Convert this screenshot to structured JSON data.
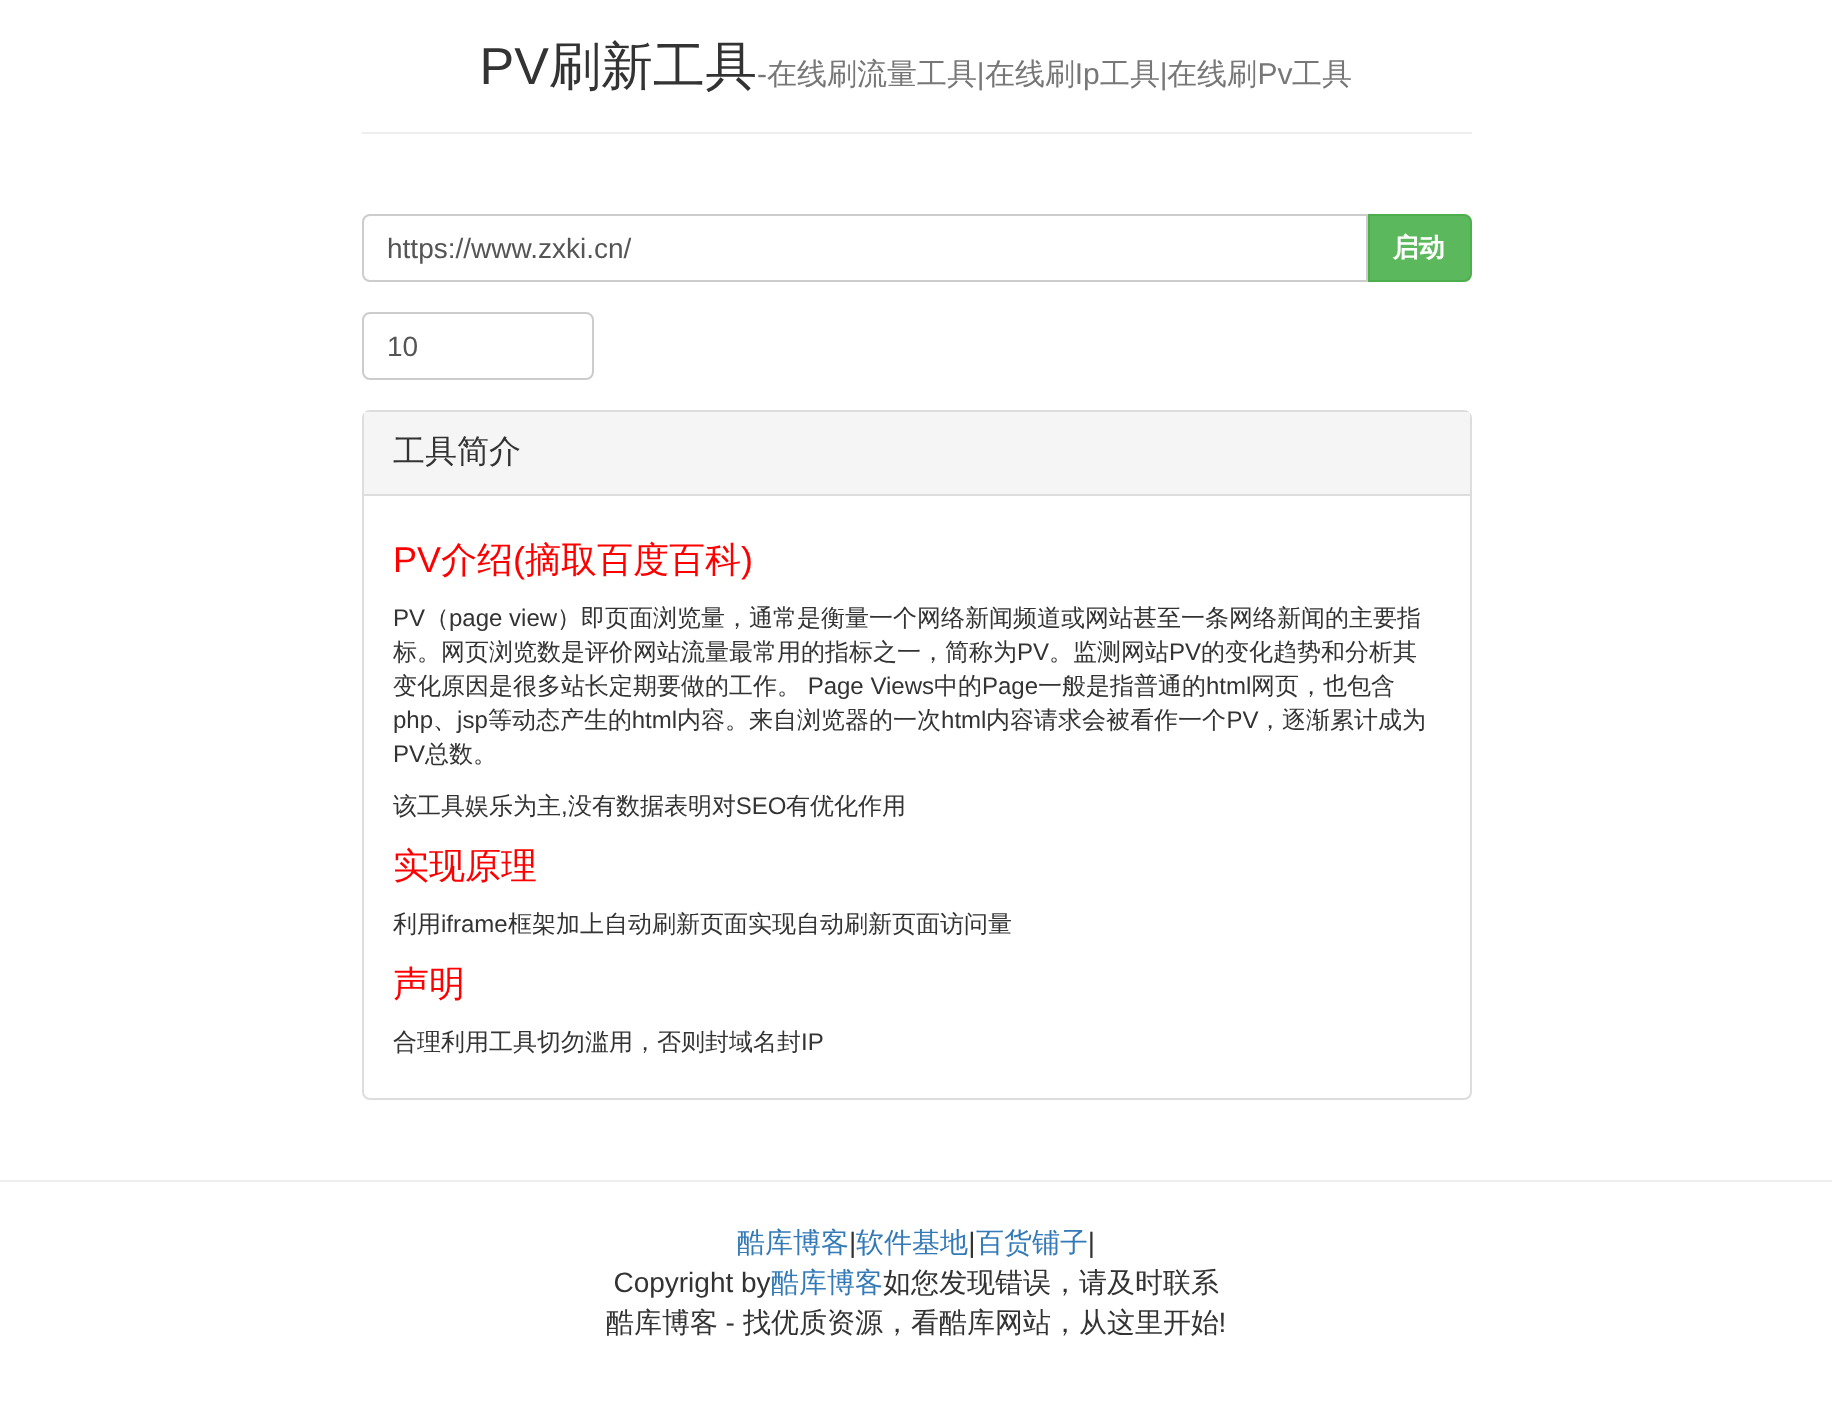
{
  "header": {
    "title": "PV刷新工具",
    "subtitle": "-在线刷流量工具|在线刷Ip工具|在线刷Pv工具"
  },
  "form": {
    "url_value": "https://www.zxki.cn/",
    "start_button": "启动",
    "count_value": "10"
  },
  "panel": {
    "heading": "工具简介",
    "sections": [
      {
        "title": "PV介绍(摘取百度百科)",
        "paragraphs": [
          "PV（page view）即页面浏览量，通常是衡量一个网络新闻频道或网站甚至一条网络新闻的主要指标。网页浏览数是评价网站流量最常用的指标之一，简称为PV。监测网站PV的变化趋势和分析其变化原因是很多站长定期要做的工作。 Page Views中的Page一般是指普通的html网页，也包含php、jsp等动态产生的html内容。来自浏览器的一次html内容请求会被看作一个PV，逐渐累计成为PV总数。",
          "该工具娱乐为主,没有数据表明对SEO有优化作用"
        ]
      },
      {
        "title": "实现原理",
        "paragraphs": [
          "利用iframe框架加上自动刷新页面实现自动刷新页面访问量"
        ]
      },
      {
        "title": "声明",
        "paragraphs": [
          "合理利用工具切勿滥用，否则封域名封IP"
        ]
      }
    ]
  },
  "footer": {
    "links": [
      "酷库博客",
      "软件基地",
      "百货铺子"
    ],
    "separator": "|",
    "copyright_prefix": "Copyright by",
    "copyright_link": "酷库博客",
    "copyright_suffix": "如您发现错误，请及时联系",
    "slogan": "酷库博客 - 找优质资源，看酷库网站，从这里开始!"
  }
}
